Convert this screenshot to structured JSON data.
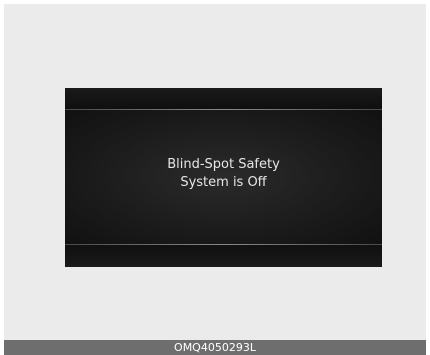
{
  "display": {
    "message_line1": "Blind-Spot Safety",
    "message_line2": "System is Off"
  },
  "caption": {
    "code": "OMQ4050293L"
  },
  "colors": {
    "frame_background": "#ebebeb",
    "display_background": "#141414",
    "message_text": "#e6e6e6",
    "caption_bar": "#6e6e6e"
  }
}
